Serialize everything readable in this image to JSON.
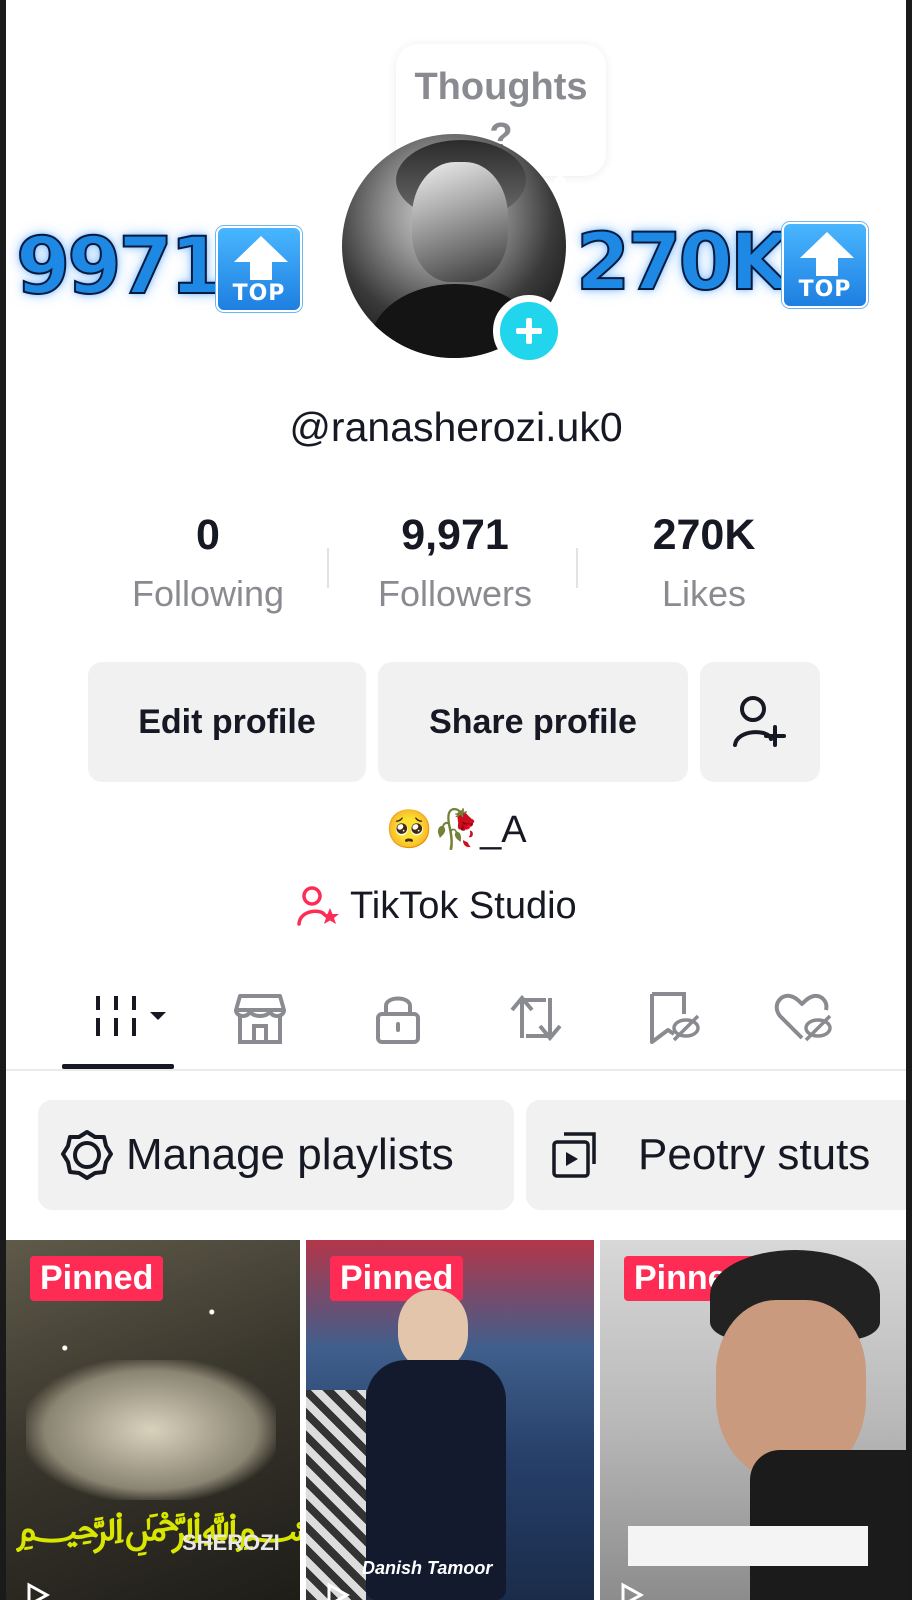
{
  "overlay": {
    "left_number": "9971",
    "right_number": "270K",
    "badge_text": "TOP"
  },
  "profile": {
    "thought_bubble": "Thoughts\n?",
    "username": "@ranasherozi.uk0",
    "bio": "🥺🥀_A",
    "studio_label": "TikTok Studio"
  },
  "stats": [
    {
      "value": "0",
      "label": "Following"
    },
    {
      "value": "9,971",
      "label": "Followers"
    },
    {
      "value": "270K",
      "label": "Likes"
    }
  ],
  "buttons": {
    "edit": "Edit profile",
    "share": "Share profile",
    "add_friend_icon": "add-friend-icon"
  },
  "tabs": [
    {
      "icon": "videos-grid-icon",
      "active": true
    },
    {
      "icon": "shop-icon"
    },
    {
      "icon": "lock-icon"
    },
    {
      "icon": "repost-icon"
    },
    {
      "icon": "favorites-hidden-icon"
    },
    {
      "icon": "liked-hidden-icon"
    }
  ],
  "chips": {
    "manage": "Manage playlists",
    "playlist": "Peotry stuts"
  },
  "videos": [
    {
      "pinned": "Pinned",
      "overlay_text": "SHEROZI"
    },
    {
      "pinned": "Pinned",
      "overlay_text": "Danish Tamoor"
    },
    {
      "pinned": "Pinned"
    }
  ],
  "colors": {
    "accent_red": "#fe2c55",
    "accent_cyan": "#20d5ec",
    "overlay_blue": "#1e88e5"
  }
}
